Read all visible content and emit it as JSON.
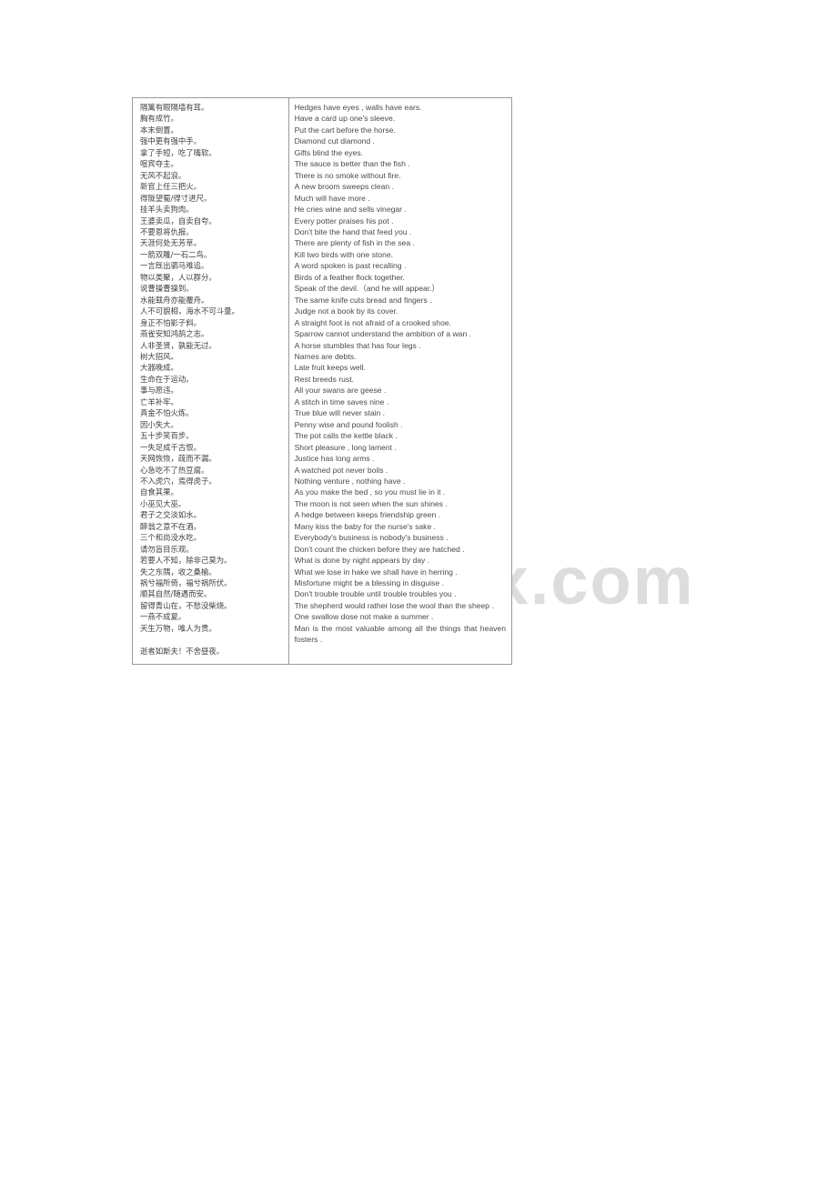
{
  "watermark": {
    "text": "www.bdocx.com"
  },
  "table": {
    "columns": [
      {
        "name": "chinese",
        "header": ""
      },
      {
        "name": "english",
        "header": ""
      }
    ],
    "chinese_lines": [
      "隔篱有眼隔墙有耳。",
      "胸有成竹。",
      "本末倒置。",
      "强中更有强中手。",
      "拿了手短，吃了嘴软。",
      "喧宾夺主。",
      "无风不起浪。",
      "新官上任三把火。",
      "得陇望蜀/得寸进尺。",
      "挂羊头卖狗肉。",
      "王婆卖瓜，自卖自夸。",
      "不要恩将仇报。",
      "天涯何处无芳草。",
      "一箭双雕/一石二鸟。",
      "一言既出驷马难追。",
      "物以类聚，人以群分。",
      "说曹操曹操到。",
      "水能载舟亦能覆舟。",
      "人不可貌相，海水不可斗量。",
      "身正不怕影子斜。",
      "燕雀安知鸿鹄之志。",
      "人非圣贤，孰能无过。",
      "树大招风。",
      "大器晚成。",
      "生命在于运动。",
      "事与愿违。",
      "亡羊补牢。",
      "真金不怕火炼。",
      "因小失大。",
      "五十步笑百步。",
      "一失足成千古恨。",
      "天网恢恢，疏而不漏。",
      "心急吃不了热豆腐。",
      "不入虎穴，焉得虎子。",
      "自食其果。",
      "小巫见大巫。",
      "君子之交淡如水。",
      "醉翁之意不在酒。",
      "三个和尚没水吃。",
      "请勿盲目乐观。",
      "若要人不知，除非己莫为。",
      "失之东隅，收之桑榆。",
      "祸兮福所倚，福兮祸所伏。",
      "顺其自然/随遇而安。",
      "留得青山在，不愁没柴烧。",
      "一燕不成夏。",
      "天生万物，唯人为贵。",
      "",
      "逝者如斯夫！不舍昼夜。"
    ],
    "english_lines": [
      "Hedges have eyes , walls have ears.",
      "Have a card up one's sleeve.",
      "Put the cart before the horse.",
      "Diamond cut diamond .",
      "Gifts blind the eyes.",
      "The sauce is better than the fish .",
      "There is no smoke without fire.",
      "A new broom sweeps clean .",
      "Much will have more .",
      "He cries wine and sells vinegar .",
      "Every potter praises his pot .",
      "Don't bite the hand that feed you .",
      "There are plenty of fish in the sea .",
      "Kill two birds with one stone.",
      "A word spoken is past recalling .",
      "Birds of a feather flock together.",
      "Speak of the devil.（and he will appear.）",
      "The same knife cuts bread and fingers .",
      "Judge not a book by its cover.",
      "A straight foot is not afraid of a crooked shoe.",
      "Sparrow cannot understand the ambition of a wan .",
      "A horse stumbles that has four legs .",
      "Names are debts.",
      "Late fruit keeps well.",
      "Rest breeds rust.",
      "All your swans are geese .",
      "A stitch in time saves nine .",
      "True blue will never stain .",
      "Penny wise and pound foolish .",
      "The pot calls the kettle black .",
      "Short pleasure , long lament .",
      "Justice has long arms .",
      "A watched pot never boils .",
      "Nothing venture , nothing have .",
      "As you make the bed , so you must lie in it .",
      "The moon is not seen when the sun shines .",
      "A hedge between keeps friendship green .",
      "Many kiss the baby for the nurse's sake .",
      "Everybody's business is nobody's business .",
      "Don't count the chicken before they are hatched .",
      "What is done by night appears by day .",
      "What we lose in hake we shall have in herring .",
      "Misfortune might be a blessing in disguise .",
      "Don't trouble trouble until trouble troubles you .",
      "The shepherd would rather lose the wool than the sheep .",
      "One swallow dose not make a summer .",
      "Man is the most valuable among all the things that heaven fosters ."
    ]
  }
}
